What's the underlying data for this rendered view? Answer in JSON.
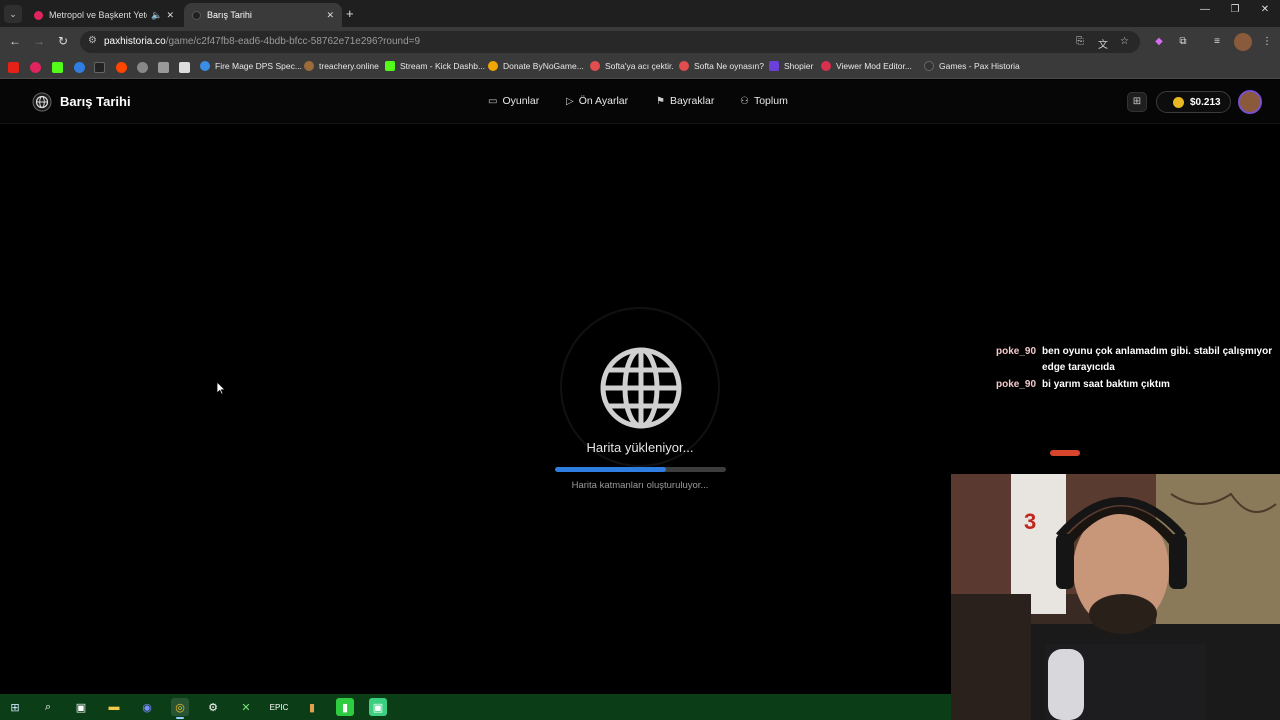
{
  "browser": {
    "tabs": [
      {
        "title": "Metropol ve Başkent Yeter",
        "favicon_color": "#e0245e",
        "active": false
      },
      {
        "title": "Barış Tarihi",
        "favicon_color": "#202020",
        "active": true
      }
    ],
    "url_host": "paxhistoria.co",
    "url_path": "/game/c2f47fb8-ead6-4bdb-bfcc-58762e71e296?round=9"
  },
  "bookmarks": [
    {
      "label": "Fire Mage DPS Spec...",
      "color": "#3a8ee6"
    },
    {
      "label": "treachery.online",
      "color": "#9b6b3a"
    },
    {
      "label": "Stream - Kick Dashb...",
      "color": "#53fc18"
    },
    {
      "label": "Donate ByNoGame...",
      "color": "#f0a500"
    },
    {
      "label": "Softa'ya acı çektir.",
      "color": "#e04e4e"
    },
    {
      "label": "Softa Ne oynasın?",
      "color": "#e04e4e"
    },
    {
      "label": "Shopier",
      "color": "#6b3fd9"
    },
    {
      "label": "Viewer Mod Editor...",
      "color": "#d9304e"
    },
    {
      "label": "Games - Pax Historia",
      "color": "#333333"
    }
  ],
  "app": {
    "brand": "Barış Tarihi",
    "nav": [
      {
        "label": "Oyunlar",
        "icon": "gamepad-icon"
      },
      {
        "label": "Ön Ayarlar",
        "icon": "play-icon"
      },
      {
        "label": "Bayraklar",
        "icon": "flag-icon"
      },
      {
        "label": "Toplum",
        "icon": "users-icon"
      }
    ],
    "balance": "$0.213"
  },
  "loading": {
    "title": "Harita yükleniyor...",
    "subtitle": "Harita katmanları oluşturuluyor...",
    "progress_fraction": 0.65,
    "accent": "#2f7de1"
  },
  "chat": [
    {
      "user": "poke_90",
      "text": "ben oyunu çok anlamadım gibi. stabil çalışmıyor edge tarayıcıda"
    },
    {
      "user": "poke_90",
      "text": "bi yarım saat baktım çıktım"
    }
  ]
}
